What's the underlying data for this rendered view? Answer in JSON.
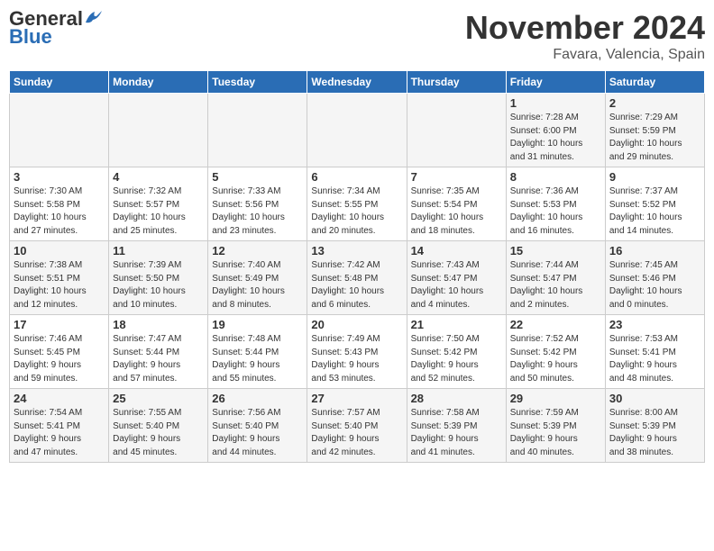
{
  "header": {
    "logo_general": "General",
    "logo_blue": "Blue",
    "month": "November 2024",
    "location": "Favara, Valencia, Spain"
  },
  "days_of_week": [
    "Sunday",
    "Monday",
    "Tuesday",
    "Wednesday",
    "Thursday",
    "Friday",
    "Saturday"
  ],
  "weeks": [
    [
      {
        "day": "",
        "info": ""
      },
      {
        "day": "",
        "info": ""
      },
      {
        "day": "",
        "info": ""
      },
      {
        "day": "",
        "info": ""
      },
      {
        "day": "",
        "info": ""
      },
      {
        "day": "1",
        "info": "Sunrise: 7:28 AM\nSunset: 6:00 PM\nDaylight: 10 hours\nand 31 minutes."
      },
      {
        "day": "2",
        "info": "Sunrise: 7:29 AM\nSunset: 5:59 PM\nDaylight: 10 hours\nand 29 minutes."
      }
    ],
    [
      {
        "day": "3",
        "info": "Sunrise: 7:30 AM\nSunset: 5:58 PM\nDaylight: 10 hours\nand 27 minutes."
      },
      {
        "day": "4",
        "info": "Sunrise: 7:32 AM\nSunset: 5:57 PM\nDaylight: 10 hours\nand 25 minutes."
      },
      {
        "day": "5",
        "info": "Sunrise: 7:33 AM\nSunset: 5:56 PM\nDaylight: 10 hours\nand 23 minutes."
      },
      {
        "day": "6",
        "info": "Sunrise: 7:34 AM\nSunset: 5:55 PM\nDaylight: 10 hours\nand 20 minutes."
      },
      {
        "day": "7",
        "info": "Sunrise: 7:35 AM\nSunset: 5:54 PM\nDaylight: 10 hours\nand 18 minutes."
      },
      {
        "day": "8",
        "info": "Sunrise: 7:36 AM\nSunset: 5:53 PM\nDaylight: 10 hours\nand 16 minutes."
      },
      {
        "day": "9",
        "info": "Sunrise: 7:37 AM\nSunset: 5:52 PM\nDaylight: 10 hours\nand 14 minutes."
      }
    ],
    [
      {
        "day": "10",
        "info": "Sunrise: 7:38 AM\nSunset: 5:51 PM\nDaylight: 10 hours\nand 12 minutes."
      },
      {
        "day": "11",
        "info": "Sunrise: 7:39 AM\nSunset: 5:50 PM\nDaylight: 10 hours\nand 10 minutes."
      },
      {
        "day": "12",
        "info": "Sunrise: 7:40 AM\nSunset: 5:49 PM\nDaylight: 10 hours\nand 8 minutes."
      },
      {
        "day": "13",
        "info": "Sunrise: 7:42 AM\nSunset: 5:48 PM\nDaylight: 10 hours\nand 6 minutes."
      },
      {
        "day": "14",
        "info": "Sunrise: 7:43 AM\nSunset: 5:47 PM\nDaylight: 10 hours\nand 4 minutes."
      },
      {
        "day": "15",
        "info": "Sunrise: 7:44 AM\nSunset: 5:47 PM\nDaylight: 10 hours\nand 2 minutes."
      },
      {
        "day": "16",
        "info": "Sunrise: 7:45 AM\nSunset: 5:46 PM\nDaylight: 10 hours\nand 0 minutes."
      }
    ],
    [
      {
        "day": "17",
        "info": "Sunrise: 7:46 AM\nSunset: 5:45 PM\nDaylight: 9 hours\nand 59 minutes."
      },
      {
        "day": "18",
        "info": "Sunrise: 7:47 AM\nSunset: 5:44 PM\nDaylight: 9 hours\nand 57 minutes."
      },
      {
        "day": "19",
        "info": "Sunrise: 7:48 AM\nSunset: 5:44 PM\nDaylight: 9 hours\nand 55 minutes."
      },
      {
        "day": "20",
        "info": "Sunrise: 7:49 AM\nSunset: 5:43 PM\nDaylight: 9 hours\nand 53 minutes."
      },
      {
        "day": "21",
        "info": "Sunrise: 7:50 AM\nSunset: 5:42 PM\nDaylight: 9 hours\nand 52 minutes."
      },
      {
        "day": "22",
        "info": "Sunrise: 7:52 AM\nSunset: 5:42 PM\nDaylight: 9 hours\nand 50 minutes."
      },
      {
        "day": "23",
        "info": "Sunrise: 7:53 AM\nSunset: 5:41 PM\nDaylight: 9 hours\nand 48 minutes."
      }
    ],
    [
      {
        "day": "24",
        "info": "Sunrise: 7:54 AM\nSunset: 5:41 PM\nDaylight: 9 hours\nand 47 minutes."
      },
      {
        "day": "25",
        "info": "Sunrise: 7:55 AM\nSunset: 5:40 PM\nDaylight: 9 hours\nand 45 minutes."
      },
      {
        "day": "26",
        "info": "Sunrise: 7:56 AM\nSunset: 5:40 PM\nDaylight: 9 hours\nand 44 minutes."
      },
      {
        "day": "27",
        "info": "Sunrise: 7:57 AM\nSunset: 5:40 PM\nDaylight: 9 hours\nand 42 minutes."
      },
      {
        "day": "28",
        "info": "Sunrise: 7:58 AM\nSunset: 5:39 PM\nDaylight: 9 hours\nand 41 minutes."
      },
      {
        "day": "29",
        "info": "Sunrise: 7:59 AM\nSunset: 5:39 PM\nDaylight: 9 hours\nand 40 minutes."
      },
      {
        "day": "30",
        "info": "Sunrise: 8:00 AM\nSunset: 5:39 PM\nDaylight: 9 hours\nand 38 minutes."
      }
    ]
  ]
}
